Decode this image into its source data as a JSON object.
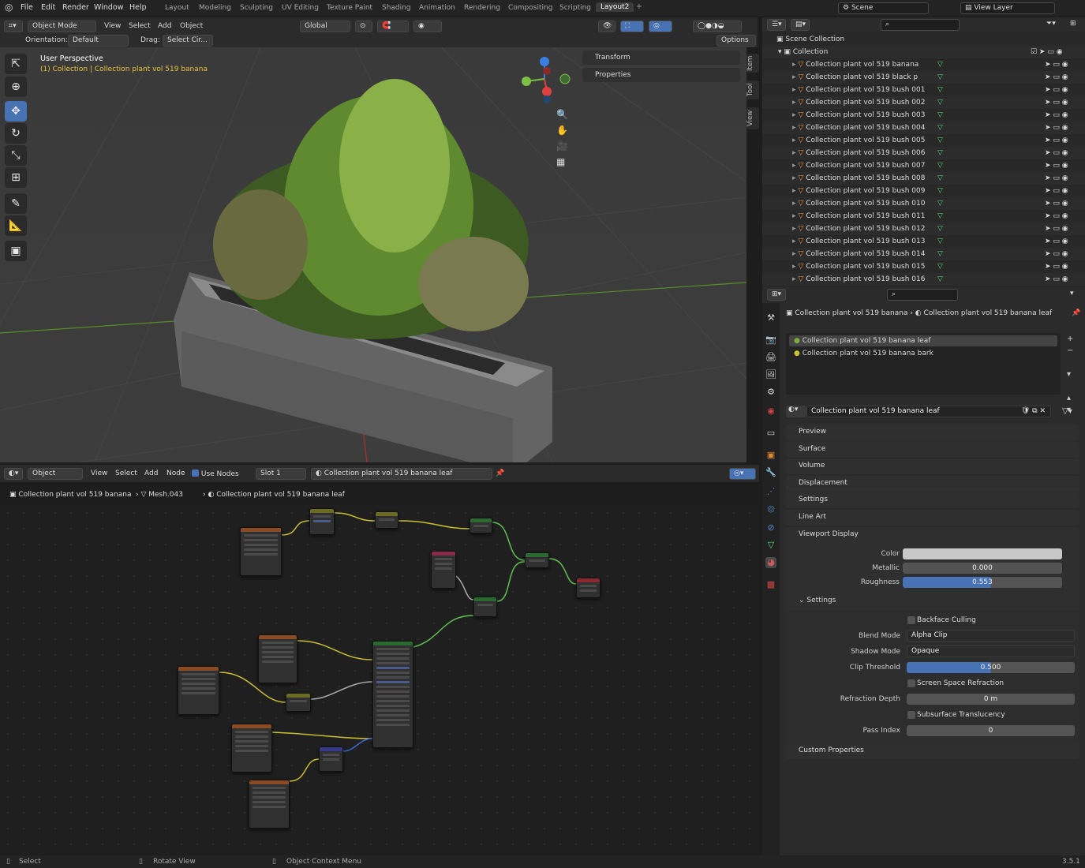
{
  "menu": [
    "File",
    "Edit",
    "Render",
    "Window",
    "Help"
  ],
  "workspaces": [
    "Layout",
    "Modeling",
    "Sculpting",
    "UV Editing",
    "Texture Paint",
    "Shading",
    "Animation",
    "Rendering",
    "Compositing",
    "Scripting",
    "Layout2"
  ],
  "scene": "Scene",
  "view_layer": "View Layer",
  "viewport": {
    "mode": "Object Mode",
    "menus": [
      "View",
      "Select",
      "Add",
      "Object"
    ],
    "transform_orient": "Global",
    "orientation_label": "Orientation:",
    "orientation": "Default",
    "drag_label": "Drag:",
    "drag": "Select Cir...",
    "options": "Options",
    "title": "User Perspective",
    "subtitle": "(1) Collection | Collection plant vol 519 banana",
    "npanels": [
      "Transform",
      "Properties"
    ],
    "tabs": [
      "Item",
      "Tool",
      "View"
    ]
  },
  "node_editor": {
    "type": "Object",
    "menus": [
      "View",
      "Select",
      "Add",
      "Node"
    ],
    "use_nodes": "Use Nodes",
    "slot": "Slot 1",
    "material": "Collection plant vol 519 banana leaf",
    "breadcrumb": [
      "Collection plant vol 519 banana",
      "Mesh.043",
      "Collection plant vol 519 banana leaf"
    ]
  },
  "outliner": {
    "root": "Scene Collection",
    "collection": "Collection",
    "items": [
      "Collection plant vol 519 banana",
      "Collection plant vol 519 black p",
      "Collection plant vol 519 bush 001",
      "Collection plant vol 519 bush 002",
      "Collection plant vol 519 bush 003",
      "Collection plant vol 519 bush 004",
      "Collection plant vol 519 bush 005",
      "Collection plant vol 519 bush 006",
      "Collection plant vol 519 bush 007",
      "Collection plant vol 519 bush 008",
      "Collection plant vol 519 bush 009",
      "Collection plant vol 519 bush 010",
      "Collection plant vol 519 bush 011",
      "Collection plant vol 519 bush 012",
      "Collection plant vol 519 bush 013",
      "Collection plant vol 519 bush 014",
      "Collection plant vol 519 bush 015",
      "Collection plant vol 519 bush 016"
    ]
  },
  "properties": {
    "breadcrumb_obj": "Collection plant vol 519 banana",
    "breadcrumb_mat": "Collection plant vol 519 banana leaf",
    "slots": [
      "Collection plant vol 519 banana leaf",
      "Collection plant vol 519 banana bark"
    ],
    "material_name": "Collection plant vol 519 banana leaf",
    "panels": [
      "Preview",
      "Surface",
      "Volume",
      "Displacement",
      "Settings",
      "Line Art",
      "Viewport Display"
    ],
    "viewport_display": {
      "color_label": "Color",
      "metallic_label": "Metallic",
      "metallic": "0.000",
      "roughness_label": "Roughness",
      "roughness": "0.553",
      "roughness_level": 0.553,
      "settings": "Settings"
    },
    "settings": {
      "backface": "Backface Culling",
      "blend_label": "Blend Mode",
      "blend": "Alpha Clip",
      "shadow_label": "Shadow Mode",
      "shadow": "Opaque",
      "clip_label": "Clip Threshold",
      "clip": "0.500",
      "clip_level": 0.5,
      "ssr": "Screen Space Refraction",
      "refr_label": "Refraction Depth",
      "refr": "0 m",
      "sss": "Subsurface Translucency",
      "pass_label": "Pass Index",
      "pass": "0"
    },
    "custom": "Custom Properties"
  },
  "status": {
    "select": "Select",
    "rotate": "Rotate View",
    "context": "Object Context Menu",
    "version": "3.5.1"
  },
  "colors": {
    "accent": "#4772b3",
    "mesh_orange": "#e09040",
    "mesh_green": "#5bd07a"
  }
}
